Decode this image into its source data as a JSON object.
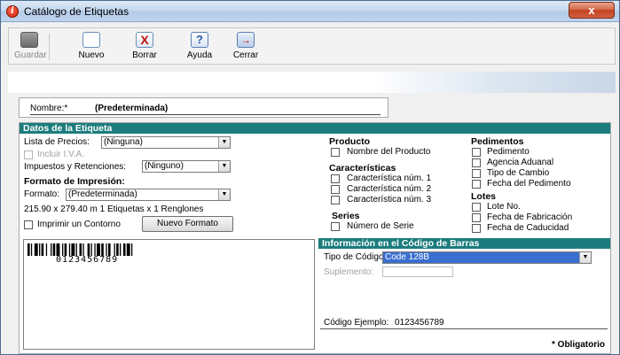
{
  "window": {
    "title": "Catálogo de Etiquetas",
    "close_glyph": "x"
  },
  "toolbar": {
    "buttons": [
      {
        "label": "Guardar",
        "icon": "save-icon",
        "enabled": false
      },
      {
        "label": "Nuevo",
        "icon": "new-document-icon",
        "enabled": true
      },
      {
        "label": "Borrar",
        "icon": "delete-icon",
        "enabled": true
      },
      {
        "label": "Ayuda",
        "icon": "help-icon",
        "enabled": true
      },
      {
        "label": "Cerrar",
        "icon": "close-door-icon",
        "enabled": true
      }
    ]
  },
  "name": {
    "label": "Nombre:*",
    "value": "(Predeterminada)"
  },
  "datos": {
    "header": "Datos de la Etiqueta",
    "price_list_label": "Lista de Precios:",
    "price_list_value": "(Ninguna)",
    "include_iva_label": "Incluir I.V.A.",
    "taxes_label": "Impuestos y Retenciones:",
    "taxes_value": "(Ninguno)",
    "print_format_heading": "Formato de Impresión:",
    "format_label": "Formato:",
    "format_value": "(Predeterminada)",
    "format_info": "215.90 x 279.40 m  1 Etiquetas x 1 Renglones",
    "outline_label": "Imprimir un Contorno",
    "new_format_button": "Nuevo Formato",
    "barcode_sample": "0123456789"
  },
  "fields": {
    "producto": {
      "heading": "Producto",
      "items": [
        "Nombre del Producto"
      ]
    },
    "caracteristicas": {
      "heading": "Características",
      "items": [
        "Característica núm. 1",
        "Característica núm. 2",
        "Característica núm. 3"
      ]
    },
    "series": {
      "heading": "Series",
      "items": [
        "Número de Serie"
      ]
    },
    "pedimentos": {
      "heading": "Pedimentos",
      "items": [
        "Pedimento",
        "Agencia Aduanal",
        "Tipo de Cambio",
        "Fecha del Pedimento"
      ]
    },
    "lotes": {
      "heading": "Lotes",
      "items": [
        "Lote No.",
        "Fecha de Fabricación",
        "Fecha de Caducidad"
      ]
    }
  },
  "barcode_info": {
    "header": "Información en el Código de Barras",
    "code_type_label": "Tipo de Código:",
    "code_type_value": "Code 128B",
    "supplement_label": "Suplemento:",
    "example_label": "Código Ejemplo:",
    "example_value": "0123456789"
  },
  "footer": {
    "required_note": "* Obligatorio"
  },
  "colors": {
    "section_header": "#1c7c7d",
    "selection": "#3a6fd0",
    "close_button": "#c2431f"
  }
}
